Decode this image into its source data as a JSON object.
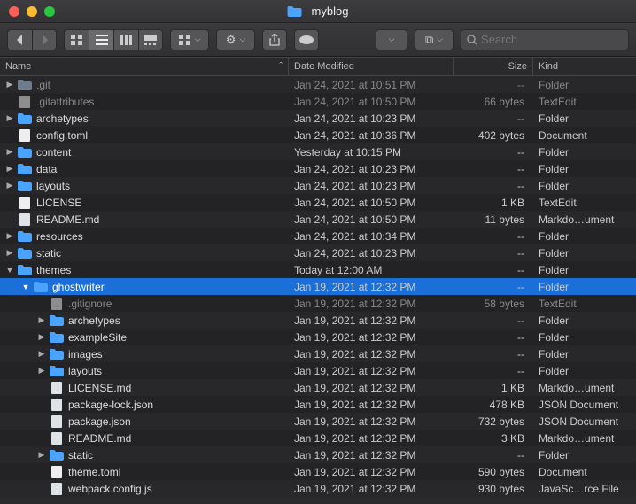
{
  "window": {
    "title": "myblog"
  },
  "search": {
    "placeholder": "Search"
  },
  "columns": {
    "name": "Name",
    "date": "Date Modified",
    "size": "Size",
    "kind": "Kind"
  },
  "rows": [
    {
      "indent": 0,
      "arrow": "right",
      "icon": "folder-dim",
      "name": ".git",
      "date": "Jan 24, 2021 at 10:51 PM",
      "size": "--",
      "kind": "Folder",
      "dim": true
    },
    {
      "indent": 0,
      "arrow": "",
      "icon": "txt",
      "name": ".gitattributes",
      "date": "Jan 24, 2021 at 10:50 PM",
      "size": "66 bytes",
      "kind": "TextEdit",
      "dim": true
    },
    {
      "indent": 0,
      "arrow": "right",
      "icon": "folder",
      "name": "archetypes",
      "date": "Jan 24, 2021 at 10:23 PM",
      "size": "--",
      "kind": "Folder"
    },
    {
      "indent": 0,
      "arrow": "",
      "icon": "doc",
      "name": "config.toml",
      "date": "Jan 24, 2021 at 10:36 PM",
      "size": "402 bytes",
      "kind": "Document"
    },
    {
      "indent": 0,
      "arrow": "right",
      "icon": "folder",
      "name": "content",
      "date": "Yesterday at 10:15 PM",
      "size": "--",
      "kind": "Folder"
    },
    {
      "indent": 0,
      "arrow": "right",
      "icon": "folder",
      "name": "data",
      "date": "Jan 24, 2021 at 10:23 PM",
      "size": "--",
      "kind": "Folder"
    },
    {
      "indent": 0,
      "arrow": "right",
      "icon": "folder",
      "name": "layouts",
      "date": "Jan 24, 2021 at 10:23 PM",
      "size": "--",
      "kind": "Folder"
    },
    {
      "indent": 0,
      "arrow": "",
      "icon": "doc",
      "name": "LICENSE",
      "date": "Jan 24, 2021 at 10:50 PM",
      "size": "1 KB",
      "kind": "TextEdit"
    },
    {
      "indent": 0,
      "arrow": "",
      "icon": "md",
      "name": "README.md",
      "date": "Jan 24, 2021 at 10:50 PM",
      "size": "11 bytes",
      "kind": "Markdo…ument"
    },
    {
      "indent": 0,
      "arrow": "right",
      "icon": "folder",
      "name": "resources",
      "date": "Jan 24, 2021 at 10:34 PM",
      "size": "--",
      "kind": "Folder"
    },
    {
      "indent": 0,
      "arrow": "right",
      "icon": "folder",
      "name": "static",
      "date": "Jan 24, 2021 at 10:23 PM",
      "size": "--",
      "kind": "Folder"
    },
    {
      "indent": 0,
      "arrow": "down",
      "icon": "folder",
      "name": "themes",
      "date": "Today at 12:00 AM",
      "size": "--",
      "kind": "Folder"
    },
    {
      "indent": 1,
      "arrow": "down",
      "icon": "folder",
      "name": "ghostwriter",
      "date": "Jan 19, 2021 at 12:32 PM",
      "size": "--",
      "kind": "Folder",
      "selected": true
    },
    {
      "indent": 2,
      "arrow": "",
      "icon": "txt",
      "name": ".gitignore",
      "date": "Jan 19, 2021 at 12:32 PM",
      "size": "58 bytes",
      "kind": "TextEdit",
      "dim": true
    },
    {
      "indent": 2,
      "arrow": "right",
      "icon": "folder",
      "name": "archetypes",
      "date": "Jan 19, 2021 at 12:32 PM",
      "size": "--",
      "kind": "Folder"
    },
    {
      "indent": 2,
      "arrow": "right",
      "icon": "folder",
      "name": "exampleSite",
      "date": "Jan 19, 2021 at 12:32 PM",
      "size": "--",
      "kind": "Folder"
    },
    {
      "indent": 2,
      "arrow": "right",
      "icon": "folder",
      "name": "images",
      "date": "Jan 19, 2021 at 12:32 PM",
      "size": "--",
      "kind": "Folder"
    },
    {
      "indent": 2,
      "arrow": "right",
      "icon": "folder",
      "name": "layouts",
      "date": "Jan 19, 2021 at 12:32 PM",
      "size": "--",
      "kind": "Folder"
    },
    {
      "indent": 2,
      "arrow": "",
      "icon": "md",
      "name": "LICENSE.md",
      "date": "Jan 19, 2021 at 12:32 PM",
      "size": "1 KB",
      "kind": "Markdo…ument"
    },
    {
      "indent": 2,
      "arrow": "",
      "icon": "json",
      "name": "package-lock.json",
      "date": "Jan 19, 2021 at 12:32 PM",
      "size": "478 KB",
      "kind": "JSON Document"
    },
    {
      "indent": 2,
      "arrow": "",
      "icon": "json",
      "name": "package.json",
      "date": "Jan 19, 2021 at 12:32 PM",
      "size": "732 bytes",
      "kind": "JSON Document"
    },
    {
      "indent": 2,
      "arrow": "",
      "icon": "md",
      "name": "README.md",
      "date": "Jan 19, 2021 at 12:32 PM",
      "size": "3 KB",
      "kind": "Markdo…ument"
    },
    {
      "indent": 2,
      "arrow": "right",
      "icon": "folder",
      "name": "static",
      "date": "Jan 19, 2021 at 12:32 PM",
      "size": "--",
      "kind": "Folder"
    },
    {
      "indent": 2,
      "arrow": "",
      "icon": "doc",
      "name": "theme.toml",
      "date": "Jan 19, 2021 at 12:32 PM",
      "size": "590 bytes",
      "kind": "Document"
    },
    {
      "indent": 2,
      "arrow": "",
      "icon": "js",
      "name": "webpack.config.js",
      "date": "Jan 19, 2021 at 12:32 PM",
      "size": "930 bytes",
      "kind": "JavaSc…rce File"
    }
  ]
}
